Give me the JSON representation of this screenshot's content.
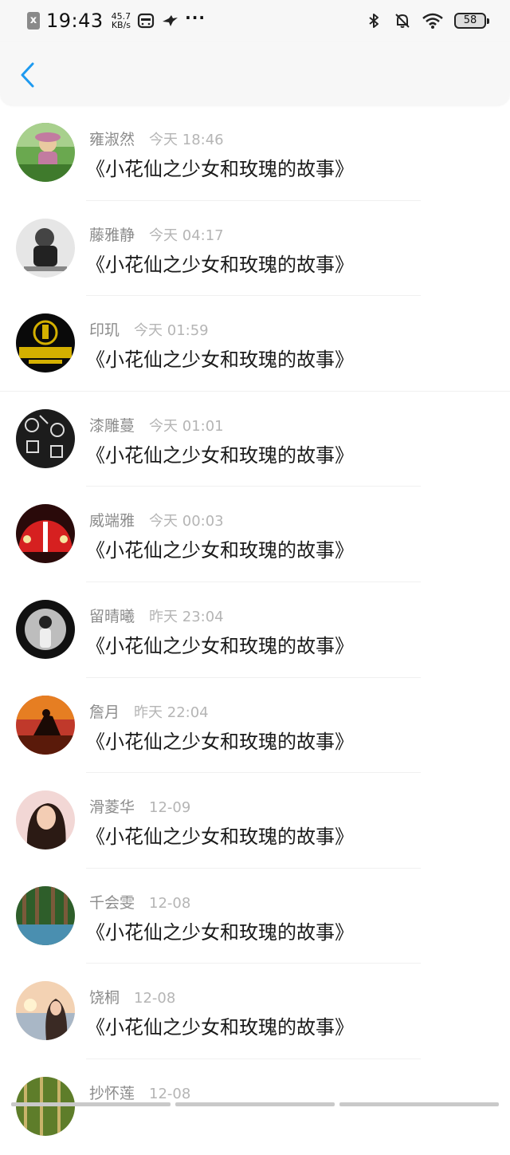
{
  "status_bar": {
    "time": "19:43",
    "net_speed_value": "45.7",
    "net_speed_unit": "KB/s",
    "sim_icon_glyph": "x",
    "battery_level": "58",
    "icons": [
      "sim-off-icon",
      "message-icon",
      "bird-icon",
      "more-dots-icon",
      "bluetooth-icon",
      "mute-icon",
      "wifi-icon",
      "battery-icon"
    ]
  },
  "nav": {
    "back_icon": "chevron-left-icon",
    "accent_color": "#1e9af0"
  },
  "items": [
    {
      "name": "雍淑然",
      "time": "今天 18:46",
      "message": "《小花仙之少女和玫瑰的故事》"
    },
    {
      "name": "藤雅静",
      "time": "今天 04:17",
      "message": "《小花仙之少女和玫瑰的故事》"
    },
    {
      "name": "印玑",
      "time": "今天 01:59",
      "message": "《小花仙之少女和玫瑰的故事》"
    },
    {
      "name": "漆雕蔓",
      "time": "今天 01:01",
      "message": "《小花仙之少女和玫瑰的故事》"
    },
    {
      "name": "威端雅",
      "time": "今天 00:03",
      "message": "《小花仙之少女和玫瑰的故事》"
    },
    {
      "name": "留晴曦",
      "time": "昨天 23:04",
      "message": "《小花仙之少女和玫瑰的故事》"
    },
    {
      "name": "詹月",
      "time": "昨天 22:04",
      "message": "《小花仙之少女和玫瑰的故事》"
    },
    {
      "name": "滑菱华",
      "time": "12-09",
      "message": "《小花仙之少女和玫瑰的故事》"
    },
    {
      "name": "千会雯",
      "time": "12-08",
      "message": "《小花仙之少女和玫瑰的故事》"
    },
    {
      "name": "饶桐",
      "time": "12-08",
      "message": "《小花仙之少女和玫瑰的故事》"
    },
    {
      "name": "抄怀莲",
      "time": "12-08",
      "message": ""
    }
  ]
}
